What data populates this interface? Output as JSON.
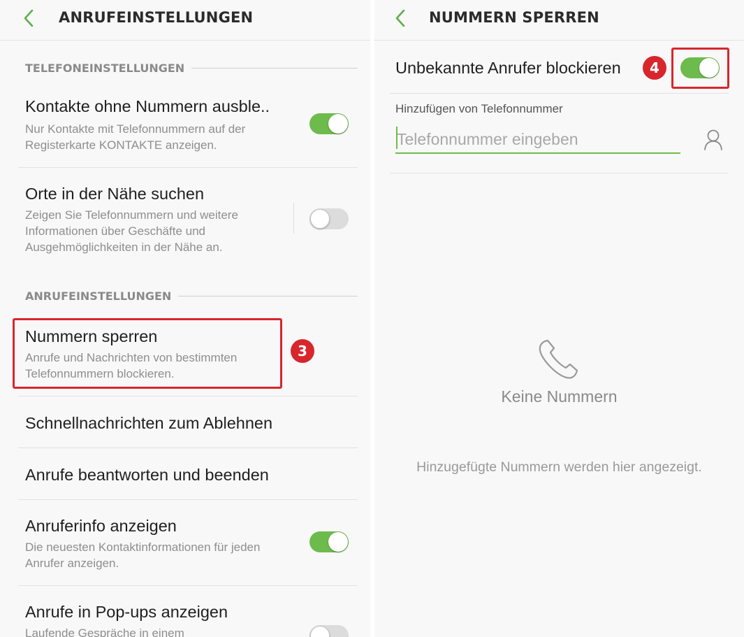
{
  "left": {
    "title": "ANRUFEINSTELLUNGEN",
    "section1": "TELEFONEINSTELLUNGEN",
    "section2": "ANRUFEINSTELLUNGEN",
    "items": [
      {
        "title": "Kontakte ohne Nummern ausble..",
        "subtitle": "Nur Kontakte mit Telefonnummern auf der Registerkarte KONTAKTE anzeigen.",
        "toggle": "on"
      },
      {
        "title": "Orte in der Nähe suchen",
        "subtitle": "Zeigen Sie Telefonnummern und weitere Informationen über Geschäfte und Ausgehmöglichkeiten in der Nähe an.",
        "toggle": "off"
      },
      {
        "title": "Nummern sperren",
        "subtitle": "Anrufe und Nachrichten von bestimmten Telefonnummern blockieren."
      },
      {
        "title": "Schnellnachrichten zum Ablehnen"
      },
      {
        "title": "Anrufe beantworten und beenden"
      },
      {
        "title": "Anruferinfo anzeigen",
        "subtitle": "Die neuesten Kontaktinformationen für jeden Anrufer anzeigen.",
        "toggle": "on"
      },
      {
        "title": "Anrufe in Pop-ups anzeigen",
        "subtitle": "Laufende Gespräche in einem",
        "toggle": "off"
      }
    ],
    "badge": "3"
  },
  "right": {
    "title": "NUMMERN SPERREN",
    "block_unknown_label": "Unbekannte Anrufer blockieren",
    "block_unknown_toggle": "on",
    "badge": "4",
    "add_label": "Hinzufügen von Telefonnummer",
    "input_placeholder": "Telefonnummer eingeben",
    "empty_title": "Keine Nummern",
    "empty_subtitle": "Hinzugefügte Nummern werden hier angezeigt."
  },
  "colors": {
    "accent": "#6dbb4d",
    "highlight": "#d8262d"
  }
}
